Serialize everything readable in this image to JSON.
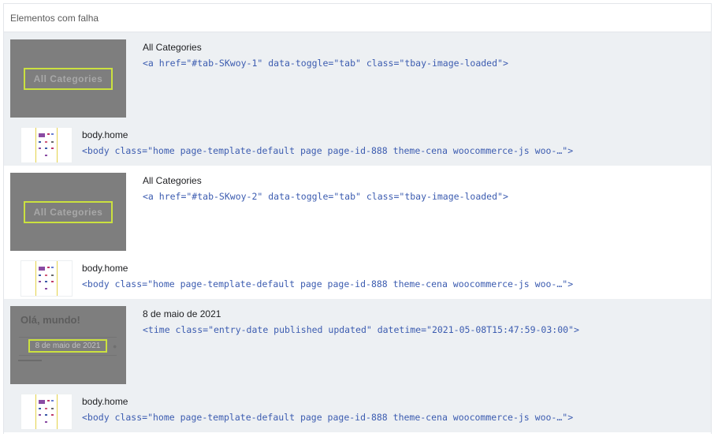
{
  "panel": {
    "title": "Elementos com falha"
  },
  "items": [
    {
      "thumb_text": "All Categories",
      "title": "All Categories",
      "code": "<a href=\"#tab-SKwoy-1\" data-toggle=\"tab\" class=\"tbay-image-loaded\">",
      "body_title": "body.home",
      "body_code": "<body class=\"home page-template-default page page-id-888 theme-cena woocommerce-js woo-…\">"
    },
    {
      "thumb_text": "All Categories",
      "title": "All Categories",
      "code": "<a href=\"#tab-SKwoy-2\" data-toggle=\"tab\" class=\"tbay-image-loaded\">",
      "body_title": "body.home",
      "body_code": "<body class=\"home page-template-default page page-id-888 theme-cena woocommerce-js woo-…\">"
    },
    {
      "thumb_heading": "Olá, mundo!",
      "thumb_text": "8 de maio de 2021",
      "title": "8 de maio de 2021",
      "code": "<time class=\"entry-date published updated\" datetime=\"2021-05-08T15:47:59-03:00\">",
      "body_title": "body.home",
      "body_code": "<body class=\"home page-template-default page page-id-888 theme-cena woocommerce-js woo-…\">"
    }
  ],
  "colors": {
    "highlight": "#cbe13f",
    "code": "#3c5cb0",
    "row_shaded": "#edf0f3",
    "thumbnail_gray": "#7e7e7e"
  }
}
